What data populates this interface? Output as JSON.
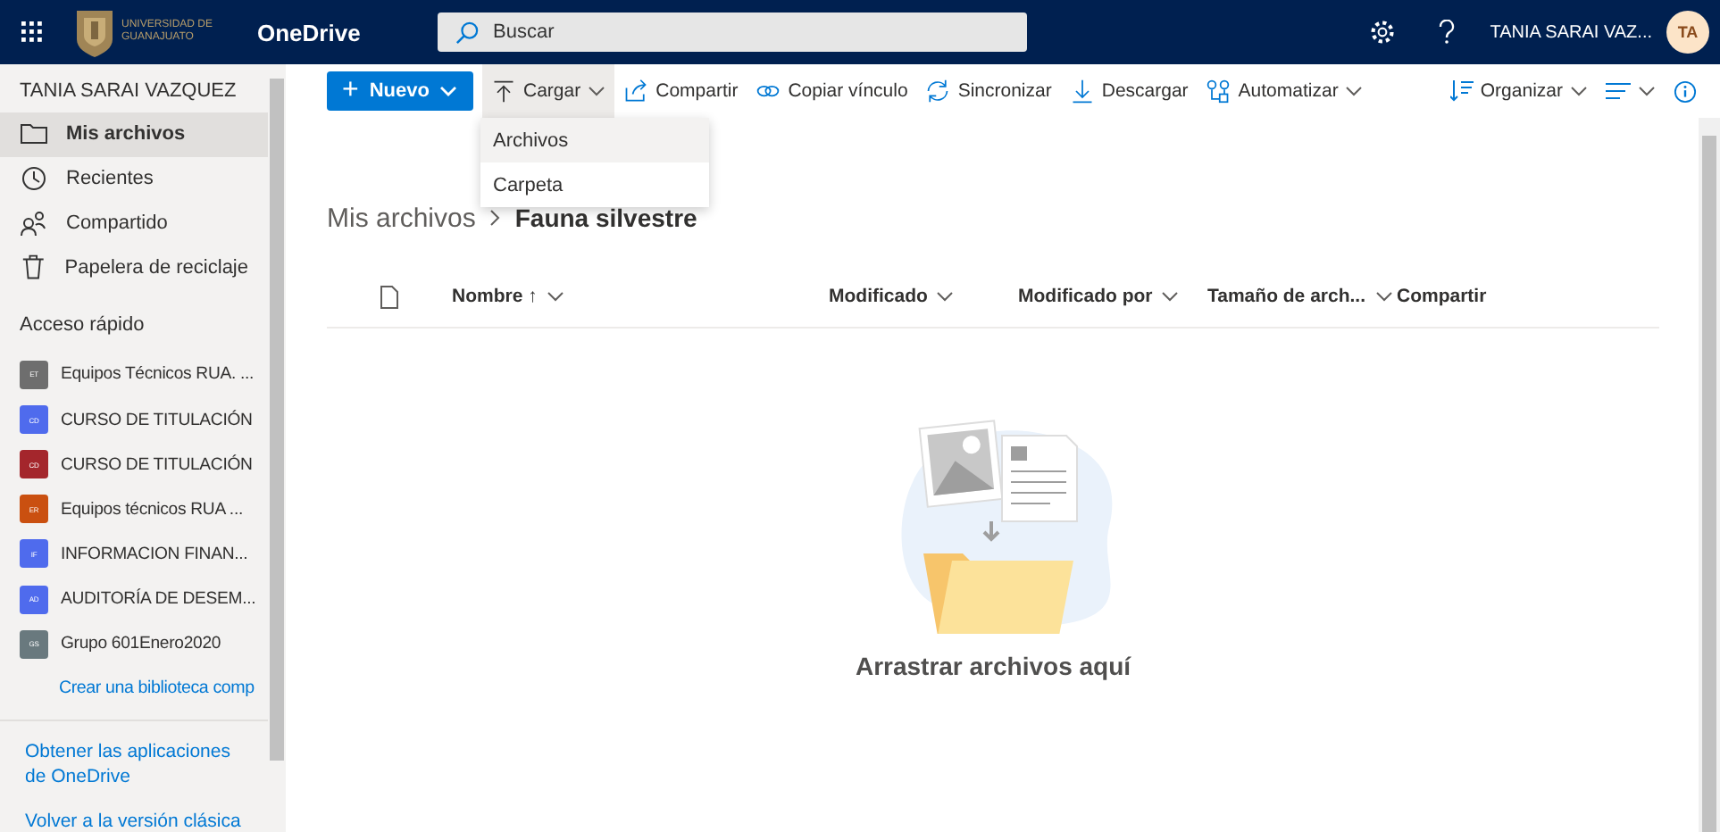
{
  "topbar": {
    "logo_text": "UNIVERSIDAD DE GUANAJUATO",
    "app_name": "OneDrive",
    "search": {
      "placeholder": "Buscar"
    },
    "user_name": "TANIA SARAI VAZ...",
    "avatar_initials": "TA"
  },
  "sidebar": {
    "user": "TANIA SARAI VAZQUEZ",
    "nav": [
      {
        "label": "Mis archivos",
        "selected": true
      },
      {
        "label": "Recientes",
        "selected": false
      },
      {
        "label": "Compartido",
        "selected": false
      },
      {
        "label": "Papelera de reciclaje",
        "selected": false
      }
    ],
    "quick_access_title": "Acceso rápido",
    "quick_access": [
      {
        "initials": "ET",
        "label": "Equipos Técnicos RUA. ...",
        "color": "#6e6e6e"
      },
      {
        "initials": "CD",
        "label": "CURSO DE TITULACIÓN",
        "color": "#4f6bed"
      },
      {
        "initials": "CD",
        "label": "CURSO DE TITULACIÓN",
        "color": "#a4262c"
      },
      {
        "initials": "ER",
        "label": "Equipos técnicos RUA ...",
        "color": "#ca5010"
      },
      {
        "initials": "IF",
        "label": "INFORMACION FINAN...",
        "color": "#4f6bed"
      },
      {
        "initials": "AD",
        "label": "AUDITORÍA DE DESEM...",
        "color": "#4f6bed"
      },
      {
        "initials": "GS",
        "label": "Grupo 601Enero2020",
        "color": "#69797e"
      }
    ],
    "create_link": "Crear una biblioteca comp",
    "footer_links": [
      "Obtener las aplicaciones de OneDrive",
      "Volver a la versión clásica"
    ]
  },
  "commands": {
    "new_button": "Nuevo",
    "new_plus": "+",
    "items": [
      {
        "label": "Cargar",
        "dropdown": true,
        "selected": true
      },
      {
        "label": "Compartir",
        "dropdown": false,
        "selected": false
      },
      {
        "label": "Copiar vínculo",
        "dropdown": false,
        "selected": false
      },
      {
        "label": "Sincronizar",
        "dropdown": false,
        "selected": false
      },
      {
        "label": "Descargar",
        "dropdown": false,
        "selected": false
      },
      {
        "label": "Automatizar",
        "dropdown": true,
        "selected": false
      }
    ],
    "sort": "Organizar"
  },
  "upload_menu": [
    {
      "label": "Archivos",
      "selected": true
    },
    {
      "label": "Carpeta",
      "selected": false
    }
  ],
  "breadcrumb": [
    "Mis archivos",
    "Fauna silvestre"
  ],
  "table": {
    "columns": [
      {
        "label": "Nombre ↑",
        "sortable": true
      },
      {
        "label": "Modificado",
        "sortable": true
      },
      {
        "label": "Modificado por",
        "sortable": true
      },
      {
        "label": "Tamaño de arch...",
        "sortable": true
      },
      {
        "label": "Compartir",
        "sortable": false
      }
    ]
  },
  "empty_state": {
    "message": "Arrastrar archivos aquí"
  }
}
